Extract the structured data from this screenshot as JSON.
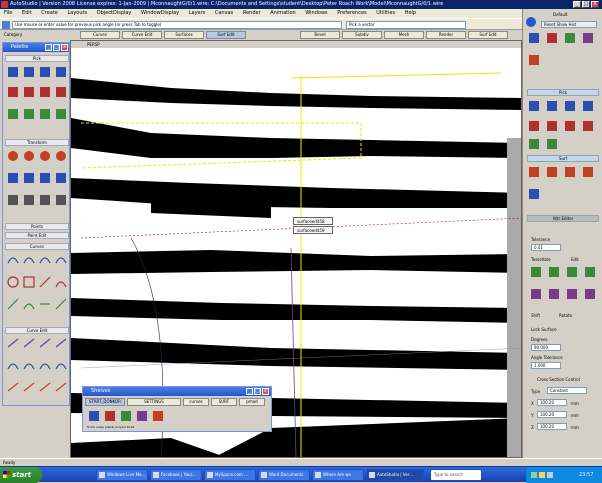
{
  "window": {
    "title": "AutoStudio | Version 2008 License expires: 1-Jan-2009 | MconnaughtG/0/1.wire: C:\\Documents and Settings\\student\\Desktop\\Peter Roach Work\\Model\\MconnaughtG/0/1.wire",
    "min": "_",
    "max": "□",
    "close": "X"
  },
  "menu": [
    "File",
    "Edit",
    "Create",
    "Layouts",
    "ObjectDisplay",
    "WindowDisplay",
    "Layers",
    "Canvas",
    "Render",
    "Animation",
    "Windows",
    "Preferences",
    "Utilities",
    "Help"
  ],
  "command_line": {
    "text": "Use mouse or enter value for previous pick angle (or press Tab to toggle)",
    "second": "Pick a vector"
  },
  "top_tabs": [
    "Curves",
    "Curve Edit",
    "Surfaces",
    "Surf Edit",
    "Bevel",
    "Subdiv",
    "Mesh",
    "Render",
    "Surf Edit"
  ],
  "category_label": "Category",
  "default_label": "Default",
  "viewport": {
    "title": "PERSP",
    "status": "Ready"
  },
  "context_menu": [
    "surfaceedit58",
    "surfaceedit59"
  ],
  "palette": {
    "title": "Palette",
    "sections": [
      {
        "label": "Pick",
        "items": [
          "nothing",
          "obj",
          "comp",
          "lasso",
          "pick",
          "layer",
          "cv",
          "curve",
          "point",
          "edit",
          "curve",
          "boundary"
        ]
      },
      {
        "label": "Transform",
        "items": [
          "move",
          "rotate",
          "scale",
          "stretch",
          "nonp",
          "set",
          "center",
          "pivot",
          "shrink",
          "bend",
          "twist",
          "cast"
        ]
      },
      {
        "label": "Points",
        "items": []
      },
      {
        "label": "Point Edit",
        "items": []
      },
      {
        "label": "Curves",
        "items": [
          "cv curve",
          "ep curve",
          "blend",
          "spline",
          "circle",
          "rect",
          "freeform",
          "line",
          "arc",
          "key point",
          "text",
          "profile"
        ]
      },
      {
        "label": "Curve Edit",
        "items": [
          "detach",
          "attach",
          "align",
          "project",
          "intersect",
          "offset",
          "fillet",
          "extend",
          "trim",
          "rebuild",
          "reverse",
          "smooth"
        ]
      }
    ]
  },
  "shelves": {
    "title": "Shelves",
    "tabs": [
      "START_DONKOR",
      "SETTINGS",
      "curves",
      "SURF",
      "pmod"
    ],
    "items": [
      "Trunk",
      "scale",
      "planar",
      "project",
      "birail"
    ]
  },
  "right_panel": {
    "top_label": "Default",
    "top_button": "Reset Show Hist",
    "tabs": [
      "Pick",
      "Surf"
    ],
    "attr_label": "Attr Editor",
    "tolerance_label": "Tolerance",
    "tolerance_value": "0.01",
    "tessellate_label": "Tessellate",
    "edit_label": "Edit",
    "lock_label": "Lock Surface",
    "shift_label": "Shift",
    "rotate_label": "Rotate",
    "degrees_label": "Degrees",
    "degrees_value": "90.000",
    "angle_label": "Angle Tolerance",
    "angle_value": "1.000",
    "cross_label": "Cross Section Control",
    "type_label": "Type",
    "type_value": "Constant",
    "x_label": "X",
    "x_value": "100.20",
    "y_label": "Y",
    "y_value": "100.20",
    "z_label": "Z",
    "z_value": "100.20",
    "units": "mm"
  },
  "taskbar": {
    "start": "start",
    "items": [
      "Windows Live Me...",
      "Facebook | Your...",
      "MySpace.com ...",
      "Word Documents",
      "Where Are we",
      "AutoStudio | Ver...",
      "Type to search"
    ],
    "clock": "23:57"
  },
  "colors": {
    "titlebar": "#0a246a",
    "taskbar": "#245ad0",
    "start": "#3c9b3c",
    "palette_cap": "#2458d0",
    "stripe": "#000000",
    "highlight": "#e8e800"
  }
}
